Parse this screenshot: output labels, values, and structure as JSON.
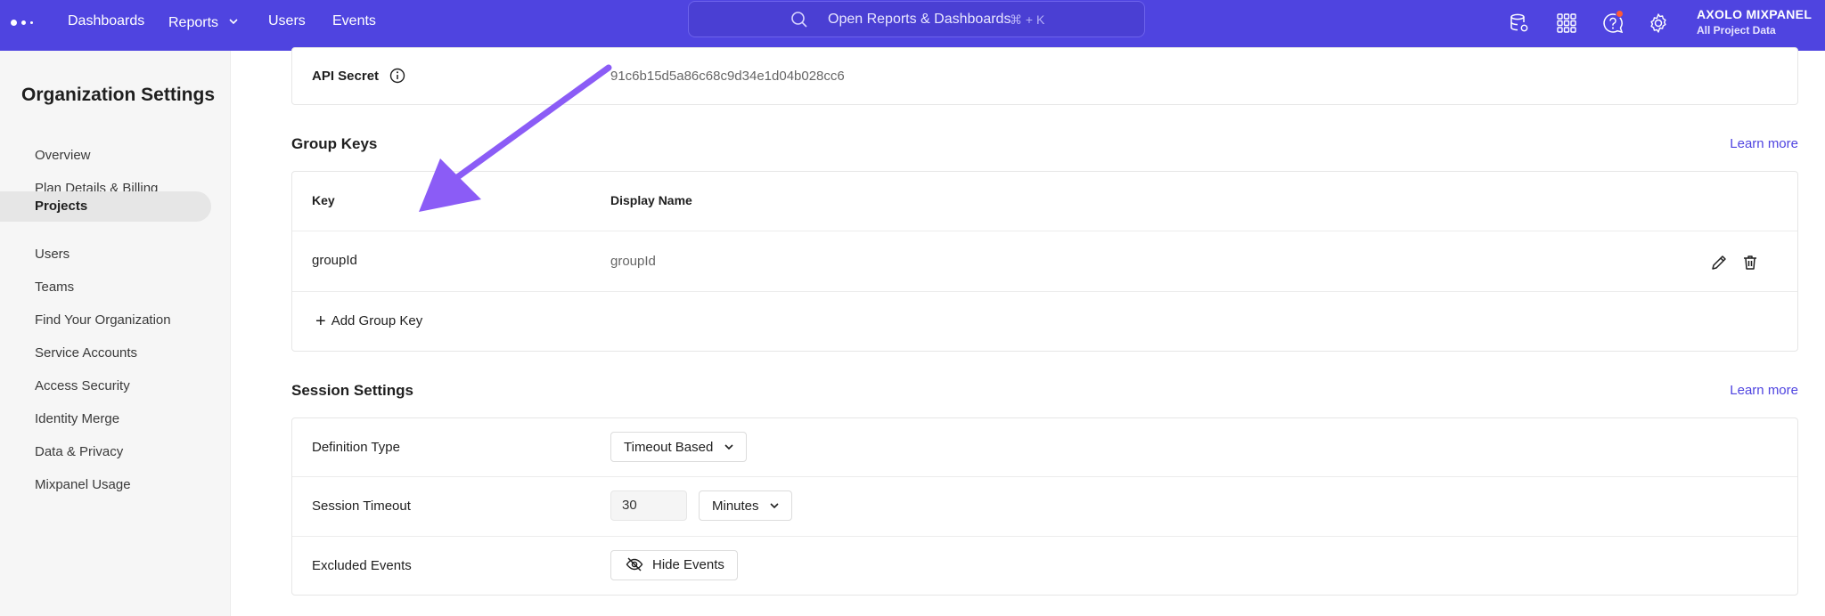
{
  "topbar": {
    "nav": [
      {
        "label": "Dashboards"
      },
      {
        "label": "Reports",
        "has_dropdown": true
      },
      {
        "label": "Users"
      },
      {
        "label": "Events"
      }
    ],
    "search": {
      "placeholder": "Open Reports & Dashboards",
      "shortcut": "⌘ + K"
    },
    "icons": [
      "database-icon",
      "apps-grid-icon",
      "help-icon",
      "settings-icon"
    ],
    "account": {
      "name": "AXOLO MIXPANEL",
      "subtitle": "All Project Data"
    },
    "colors": {
      "bar": "#4f44e0",
      "notification": "#ff5a36"
    }
  },
  "sidebar": {
    "title": "Organization Settings",
    "items": [
      {
        "label": "Overview"
      },
      {
        "label": "Plan Details & Billing"
      },
      {
        "label": "Projects",
        "active": true
      },
      {
        "label": "Users"
      },
      {
        "label": "Teams"
      },
      {
        "label": "Find Your Organization"
      },
      {
        "label": "Service Accounts"
      },
      {
        "label": "Access Security"
      },
      {
        "label": "Identity Merge"
      },
      {
        "label": "Data & Privacy"
      },
      {
        "label": "Mixpanel Usage"
      }
    ]
  },
  "api": {
    "label": "API Secret",
    "value": "91c6b15d5a86c68c9d34e1d04b028cc6"
  },
  "group_keys": {
    "title": "Group Keys",
    "learn_more": "Learn more",
    "headers": {
      "key": "Key",
      "display_name": "Display Name"
    },
    "rows": [
      {
        "key": "groupId",
        "display_name": "groupId"
      }
    ],
    "add_label": "Add Group Key"
  },
  "session": {
    "title": "Session Settings",
    "learn_more": "Learn more",
    "definition_type": {
      "label": "Definition Type",
      "value": "Timeout Based"
    },
    "timeout": {
      "label": "Session Timeout",
      "value": "30",
      "unit": "Minutes"
    },
    "excluded": {
      "label": "Excluded Events",
      "button": "Hide Events"
    }
  },
  "annotation": {
    "arrow_color": "#8b5cf6"
  }
}
